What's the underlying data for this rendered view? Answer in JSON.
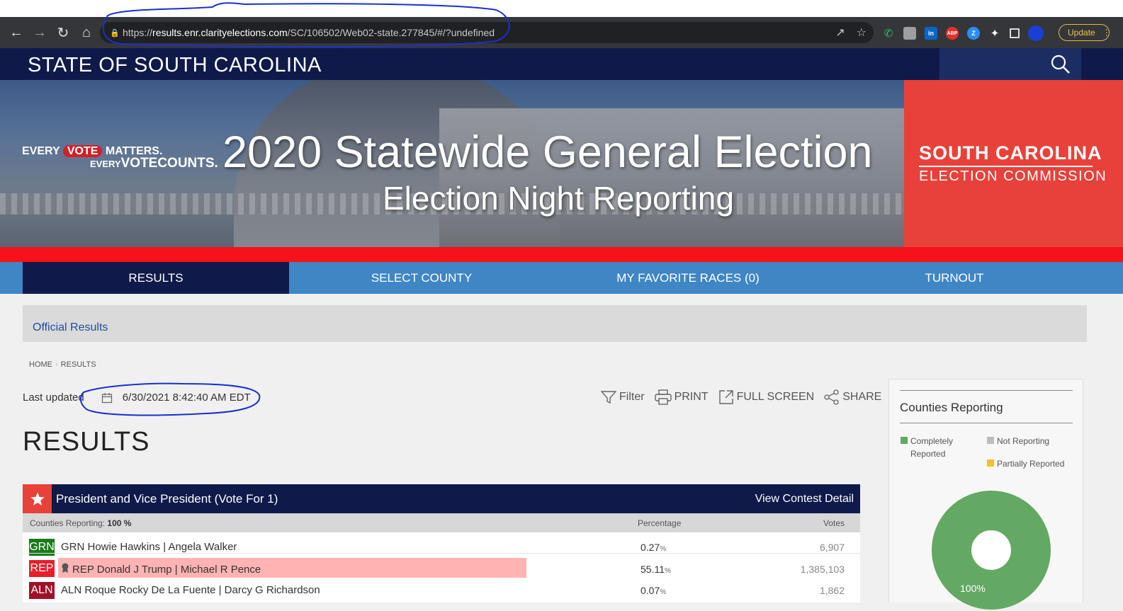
{
  "browser": {
    "url_scheme": "https://",
    "url_host": "results.enr.clarityelections.com",
    "url_path": "/SC/106502/Web02-state.277845/#/?undefined",
    "update_label": "Update",
    "extensions": [
      {
        "label": "",
        "color": "#35363a",
        "icon": "phone-icon"
      },
      {
        "label": "",
        "color": "#9e9e9e",
        "icon": "notes-icon"
      },
      {
        "label": "in",
        "color": "#0a66c2",
        "icon": "linkedin-icon"
      },
      {
        "label": "ABP",
        "color": "#e4312b",
        "icon": "adblock-icon"
      },
      {
        "label": "Z",
        "color": "#2d8cff",
        "icon": "zoom-icon"
      }
    ]
  },
  "site": {
    "state_title": "STATE OF SOUTH CAROLINA",
    "slogan_every": "EVERY",
    "slogan_vote": "VOTE",
    "slogan_matters": "MATTERS.",
    "slogan_every2": "EVERY",
    "slogan_vote2": "VOTE",
    "slogan_counts": "COUNTS.",
    "main_title": "2020 Statewide General Election",
    "sub_title": "Election Night Reporting",
    "commission_name": "SOUTH CAROLINA",
    "commission_sub": "ELECTION COMMISSION"
  },
  "nav": {
    "tabs": [
      {
        "label": "RESULTS",
        "active": true
      },
      {
        "label": "SELECT COUNTY",
        "active": false
      },
      {
        "label": "MY FAVORITE RACES  (0)",
        "active": false
      },
      {
        "label": "TURNOUT",
        "active": false
      }
    ]
  },
  "official_label": "Official Results",
  "breadcrumb": {
    "home": "HOME",
    "current": "RESULTS"
  },
  "last_updated": {
    "label": "Last updated",
    "value": "6/30/2021 8:42:40 AM EDT"
  },
  "toolbar": {
    "filter": "Filter",
    "print": "PRINT",
    "fullscreen": "FULL SCREEN",
    "share": "SHARE"
  },
  "results_heading": "RESULTS",
  "contest": {
    "name": "President and Vice President (Vote For 1)",
    "detail_link": "View Contest Detail",
    "counties_reporting_label": "Counties Reporting:",
    "counties_reporting_value": "100 %",
    "col_percentage": "Percentage",
    "col_votes": "Votes",
    "candidates": [
      {
        "party": "GRN",
        "party_color": "#1a7a1a",
        "name": "GRN Howie Hawkins | Angela Walker",
        "pct": "0.27",
        "pct_unit": "%",
        "pct_value": 0.27,
        "votes": "6,907",
        "winner": false
      },
      {
        "party": "REP",
        "party_color": "#e5202a",
        "name": "REP Donald J Trump | Michael R Pence",
        "pct": "55.11",
        "pct_unit": "%",
        "pct_value": 55.11,
        "votes": "1,385,103",
        "winner": true
      },
      {
        "party": "ALN",
        "party_color": "#a0102a",
        "name": "ALN Roque Rocky De La Fuente | Darcy G Richardson",
        "pct": "0.07",
        "pct_unit": "%",
        "pct_value": 0.07,
        "votes": "1,862",
        "winner": false
      }
    ]
  },
  "counties_panel": {
    "title": "Counties Reporting",
    "legend": [
      {
        "label": "Completely Reported",
        "color": "#63a863"
      },
      {
        "label": "Not Reporting",
        "color": "#bdbdbd"
      },
      {
        "label": "Partially Reported",
        "color": "#f2c12e"
      }
    ],
    "completely_fraction": 1.0,
    "donut_label": "100%"
  },
  "colors": {
    "navy": "#0f1a4a",
    "nav_blue": "#3f86c4",
    "accent_red": "#e8413a",
    "strip_red": "#f5121a"
  }
}
